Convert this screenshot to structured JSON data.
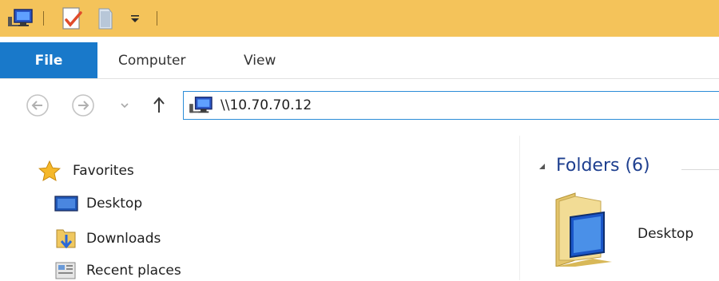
{
  "ribbon": {
    "tabs": [
      {
        "label": "File"
      },
      {
        "label": "Computer"
      },
      {
        "label": "View"
      }
    ]
  },
  "address": {
    "path": "\\\\10.70.70.12"
  },
  "nav_pane": {
    "favorites_label": "Favorites",
    "items": [
      {
        "label": "Desktop",
        "icon": "desktop-icon"
      },
      {
        "label": "Downloads",
        "icon": "downloads-icon"
      },
      {
        "label": "Recent places",
        "icon": "recent-places-icon"
      }
    ]
  },
  "content": {
    "group_title": "Folders (6)",
    "folders": [
      {
        "name": "Desktop"
      }
    ]
  },
  "colors": {
    "titlebar": "#f4c35a",
    "file_tab": "#1979ca",
    "address_border": "#2b8cd8",
    "group_title": "#1e3f8f"
  }
}
